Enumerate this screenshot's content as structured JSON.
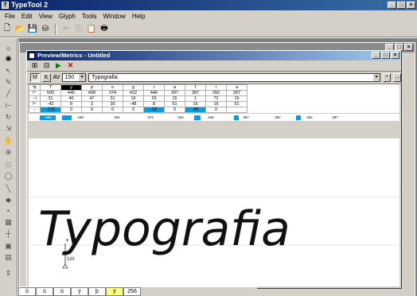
{
  "app": {
    "title": "TypeTool 2",
    "menu": [
      {
        "label": "File",
        "key": "F"
      },
      {
        "label": "Edit",
        "key": "E"
      },
      {
        "label": "View",
        "key": "V"
      },
      {
        "label": "Glyph",
        "key": "G"
      },
      {
        "label": "Tools",
        "key": "T"
      },
      {
        "label": "Window",
        "key": "W"
      },
      {
        "label": "Help",
        "key": "H"
      }
    ]
  },
  "preview": {
    "title": "Preview/Metrics - Untitled",
    "size_label": "AV",
    "size_value": "150",
    "text_value": "Typografia",
    "canvas_text": "Typografia",
    "measure_label": "120"
  },
  "metrics": {
    "glyphs": [
      "T",
      "y",
      "p",
      "o",
      "g",
      "r",
      "a",
      "f",
      "i",
      "a"
    ],
    "rows": [
      {
        "icon": "⊢",
        "values": [
          "500",
          "445",
          "408",
          "374",
          "422",
          "446",
          "397",
          "387",
          "250",
          "397"
        ]
      },
      {
        "icon": "⊣",
        "values": [
          "31",
          "40",
          "47",
          "31",
          "16",
          "29",
          "15",
          "1",
          "72",
          "15"
        ]
      },
      {
        "icon": "⊢",
        "values": [
          "-42",
          "8",
          "2",
          "30",
          "-48",
          "8",
          "51",
          "16",
          "16",
          "51"
        ]
      },
      {
        "icon": "⇔",
        "values": [
          "-123",
          "0",
          "0",
          "0",
          "0",
          "-52",
          "0",
          "-56",
          "0",
          ""
        ]
      }
    ],
    "spacing": [
      "566",
      "448",
      "404",
      "374",
      "422",
      "446",
      "397",
      "397",
      "254",
      "397"
    ]
  },
  "bottom_strip": [
    "û",
    "ü",
    "ü",
    "ý",
    "þ",
    "ÿ",
    "256"
  ]
}
